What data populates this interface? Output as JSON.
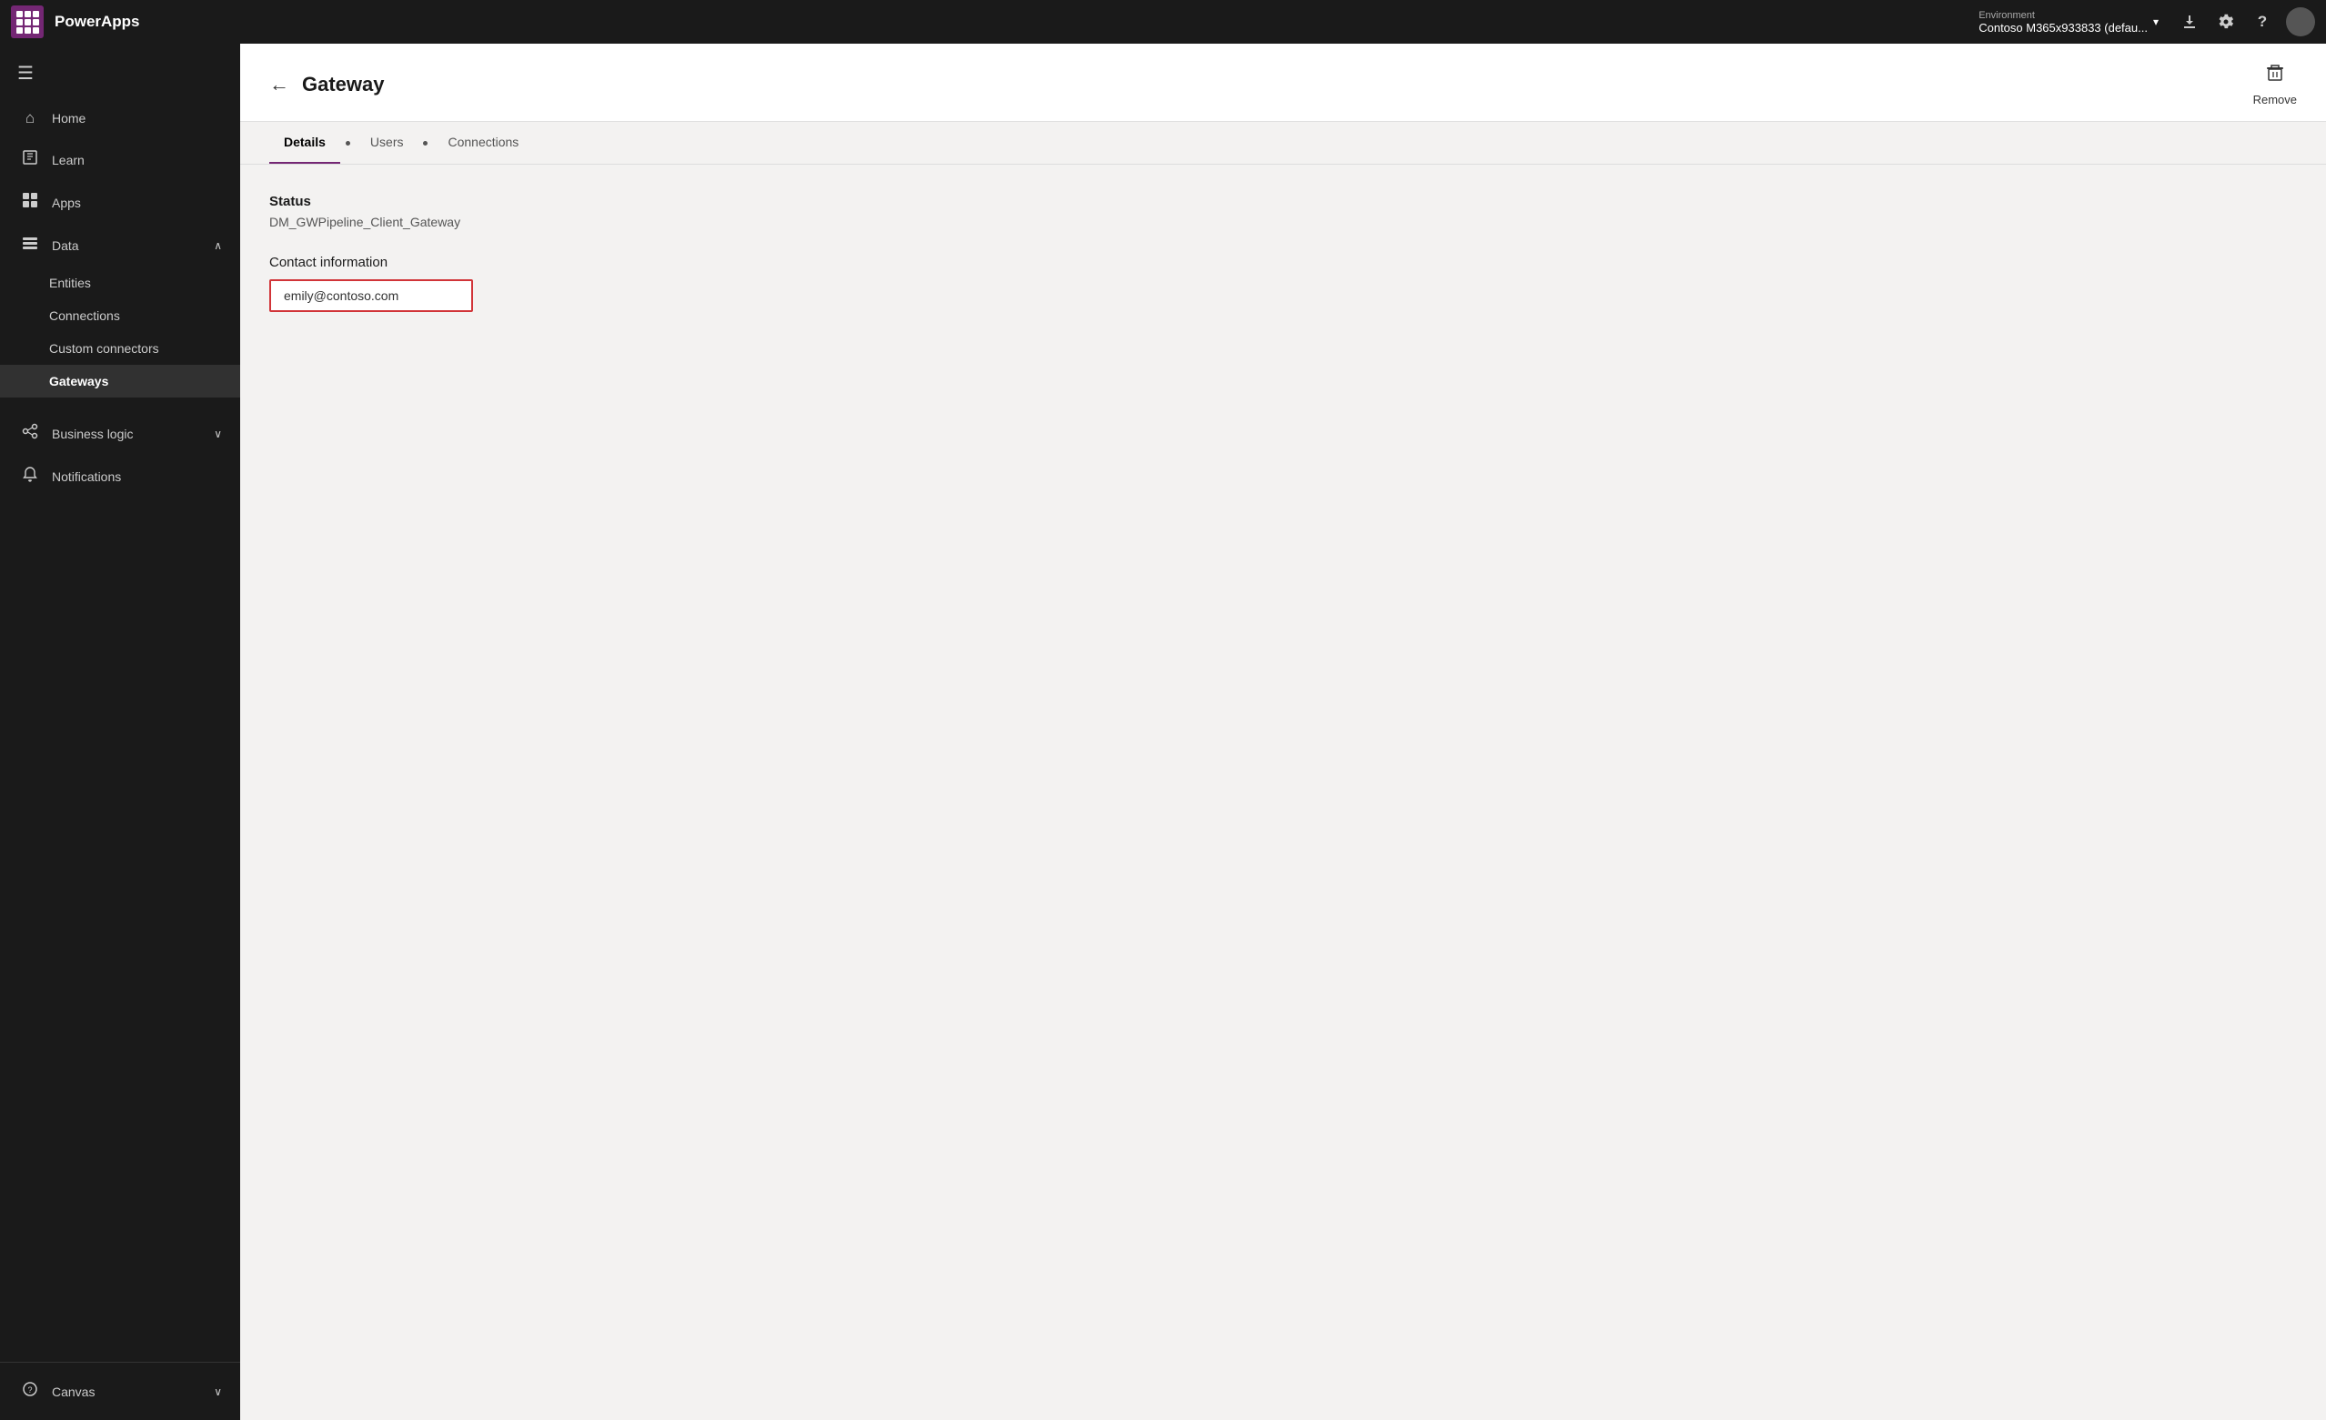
{
  "topbar": {
    "app_name": "PowerApps",
    "env_label": "Environment",
    "env_name": "Contoso M365x933833 (defau...",
    "download_icon": "⬇",
    "settings_icon": "⚙",
    "help_icon": "?",
    "avatar_initials": ""
  },
  "sidebar": {
    "menu_icon": "☰",
    "items": [
      {
        "id": "home",
        "icon": "🏠",
        "label": "Home",
        "active": false
      },
      {
        "id": "learn",
        "icon": "📖",
        "label": "Learn",
        "active": false
      },
      {
        "id": "apps",
        "icon": "🖥",
        "label": "Apps",
        "active": false
      },
      {
        "id": "data",
        "icon": "📊",
        "label": "Data",
        "active": false,
        "has_chevron": true,
        "expanded": true
      }
    ],
    "sub_items": [
      {
        "id": "entities",
        "label": "Entities"
      },
      {
        "id": "connections",
        "label": "Connections"
      },
      {
        "id": "custom-connectors",
        "label": "Custom connectors"
      },
      {
        "id": "gateways",
        "label": "Gateways",
        "active": true
      }
    ],
    "bottom_items": [
      {
        "id": "business-logic",
        "icon": "⤴",
        "label": "Business logic",
        "has_chevron": true
      },
      {
        "id": "notifications",
        "icon": "🔔",
        "label": "Notifications"
      }
    ],
    "footer_item": {
      "id": "canvas",
      "icon": "?",
      "label": "Canvas",
      "has_chevron": true
    }
  },
  "page": {
    "title": "Gateway",
    "back_label": "←",
    "remove_label": "Remove"
  },
  "tabs": [
    {
      "id": "details",
      "label": "Details",
      "active": true
    },
    {
      "id": "users",
      "label": "Users"
    },
    {
      "id": "connections",
      "label": "Connections"
    }
  ],
  "content": {
    "status_label": "Status",
    "status_value": "DM_GWPipeline_Client_Gateway",
    "contact_label": "Contact information",
    "contact_email": "emily@contoso.com"
  }
}
